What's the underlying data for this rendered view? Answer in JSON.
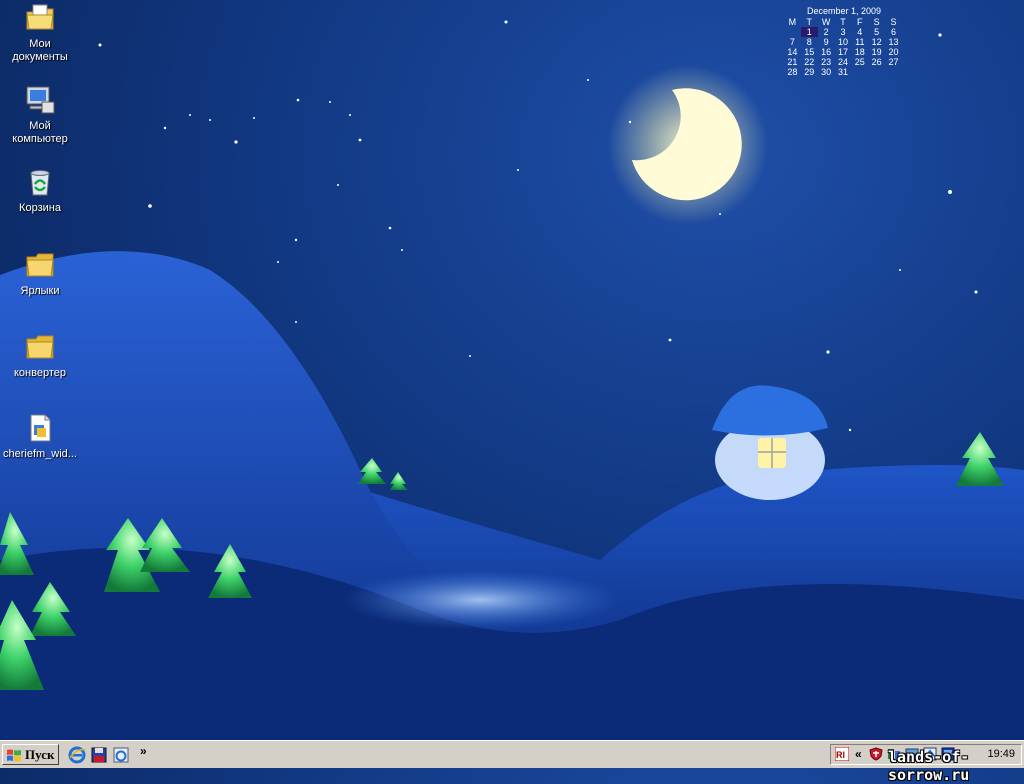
{
  "desktop": {
    "icons": [
      {
        "label": "Мои документы",
        "icon": "my-documents-icon"
      },
      {
        "label": "Мой компьютер",
        "icon": "my-computer-icon"
      },
      {
        "label": "Корзина",
        "icon": "recycle-bin-icon"
      },
      {
        "label": "Ярлыки",
        "icon": "folder-icon"
      },
      {
        "label": "конвертер",
        "icon": "folder-icon"
      },
      {
        "label": "cheriefm_wid...",
        "icon": "setup-file-icon"
      }
    ]
  },
  "calendar": {
    "title": "December 1, 2009",
    "weekdays": [
      "M",
      "T",
      "W",
      "T",
      "F",
      "S",
      "S"
    ],
    "weeks": [
      [
        "",
        "1",
        "2",
        "3",
        "4",
        "5",
        "6"
      ],
      [
        "7",
        "8",
        "9",
        "10",
        "11",
        "12",
        "13"
      ],
      [
        "14",
        "15",
        "16",
        "17",
        "18",
        "19",
        "20"
      ],
      [
        "21",
        "22",
        "23",
        "24",
        "25",
        "26",
        "27"
      ],
      [
        "28",
        "29",
        "30",
        "31",
        "",
        "",
        ""
      ]
    ],
    "today": "1",
    "today_color": "#2a1a6e"
  },
  "taskbar": {
    "start_label": "Пуск",
    "quicklaunch": [
      "internet-explorer-icon",
      "save-disk-icon",
      "browser-icon"
    ],
    "chevron": "»",
    "tray_chevron": "«",
    "tray_icons": [
      "rl-icon",
      "shield-icon",
      "network-icon",
      "monitor-icon",
      "update-icon",
      "display-icon"
    ],
    "clock": "19:49",
    "background": "#d4d0c8"
  },
  "watermark": "lands-of-sorrow.ru"
}
